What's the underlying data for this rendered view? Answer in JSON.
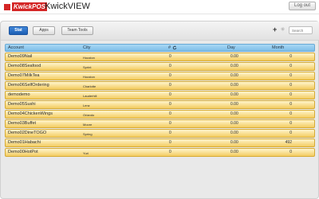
{
  "header": {
    "logo_text": "KwickPOS",
    "app_title": "KwickVIEW",
    "logout_label": "Log out"
  },
  "toolbar": {
    "stat_label": "Stat",
    "apps_label": "Apps",
    "team_label": "Team Tools",
    "add_icon": "plus-icon",
    "settings_icon": "gear-icon",
    "search_placeholder": "Search"
  },
  "table": {
    "columns": {
      "account": "Account",
      "city": "City",
      "count": "#",
      "day": "Day",
      "month": "Month"
    },
    "rows": [
      {
        "account": "Demo09Nail",
        "city": "Houston",
        "count": "0",
        "day": "0.00",
        "month": "0"
      },
      {
        "account": "Demo08Seafood",
        "city": "Sprint",
        "count": "0",
        "day": "0.00",
        "month": "0"
      },
      {
        "account": "Demo07MilkTea",
        "city": "Houston",
        "count": "0",
        "day": "0.00",
        "month": "0"
      },
      {
        "account": "Demo06SelfOrdering",
        "city": "Charlotte",
        "count": "0",
        "day": "0.00",
        "month": "0"
      },
      {
        "account": "demodemo",
        "city": "Lauderhill",
        "count": "0",
        "day": "0.00",
        "month": "0"
      },
      {
        "account": "Demo05Sushi",
        "city": "Lenz",
        "count": "0",
        "day": "0.00",
        "month": "0"
      },
      {
        "account": "Demo04ChickenWings",
        "city": "Orlando",
        "count": "0",
        "day": "0.00",
        "month": "0"
      },
      {
        "account": "Demo03Buffet",
        "city": "Moore",
        "count": "0",
        "day": "0.00",
        "month": "0"
      },
      {
        "account": "Demo02DineTOGO",
        "city": "Spring",
        "count": "0",
        "day": "0.00",
        "month": "0"
      },
      {
        "account": "Demo01Habachi",
        "city": "",
        "count": "0",
        "day": "0.00",
        "month": "492"
      },
      {
        "account": "Demo00HotPot",
        "city": "Yuri",
        "count": "0",
        "day": "0.00",
        "month": "0"
      }
    ]
  },
  "colors": {
    "brand": "#d42626",
    "stat_button": "#2a6fc4",
    "header_row": "#8ec8ee",
    "row_gold": "#f3cc60"
  }
}
